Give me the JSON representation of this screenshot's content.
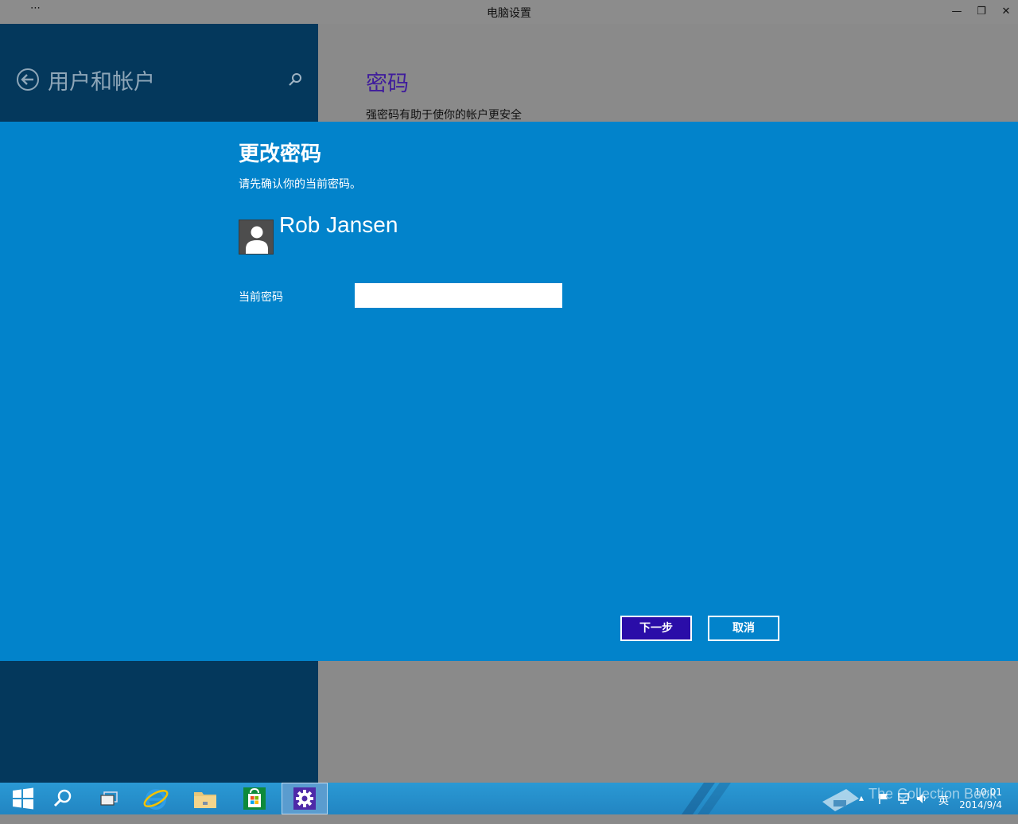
{
  "window": {
    "title": "电脑设置",
    "menu_glyph": "⋯",
    "minimize_glyph": "—",
    "restore_glyph": "❐",
    "close_glyph": "✕"
  },
  "left_pane": {
    "title": "用户和帐户"
  },
  "right_pane": {
    "title": "密码",
    "description": "强密码有助于使你的帐户更安全"
  },
  "dialog": {
    "title": "更改密码",
    "subtitle": "请先确认你的当前密码。",
    "user_name": "Rob Jansen",
    "field_label": "当前密码",
    "field_value": "",
    "next_label": "下一步",
    "cancel_label": "取消"
  },
  "taskbar": {
    "clock_time": "10:01",
    "clock_date": "2014/9/4",
    "ime_label": "英",
    "watermark": "The Collection Book"
  },
  "colors": {
    "dialog_bg": "#0283cb",
    "left_pane_bg": "#04385c",
    "accent_purple": "#3f1c9c",
    "next_button": "#2a0da8"
  }
}
